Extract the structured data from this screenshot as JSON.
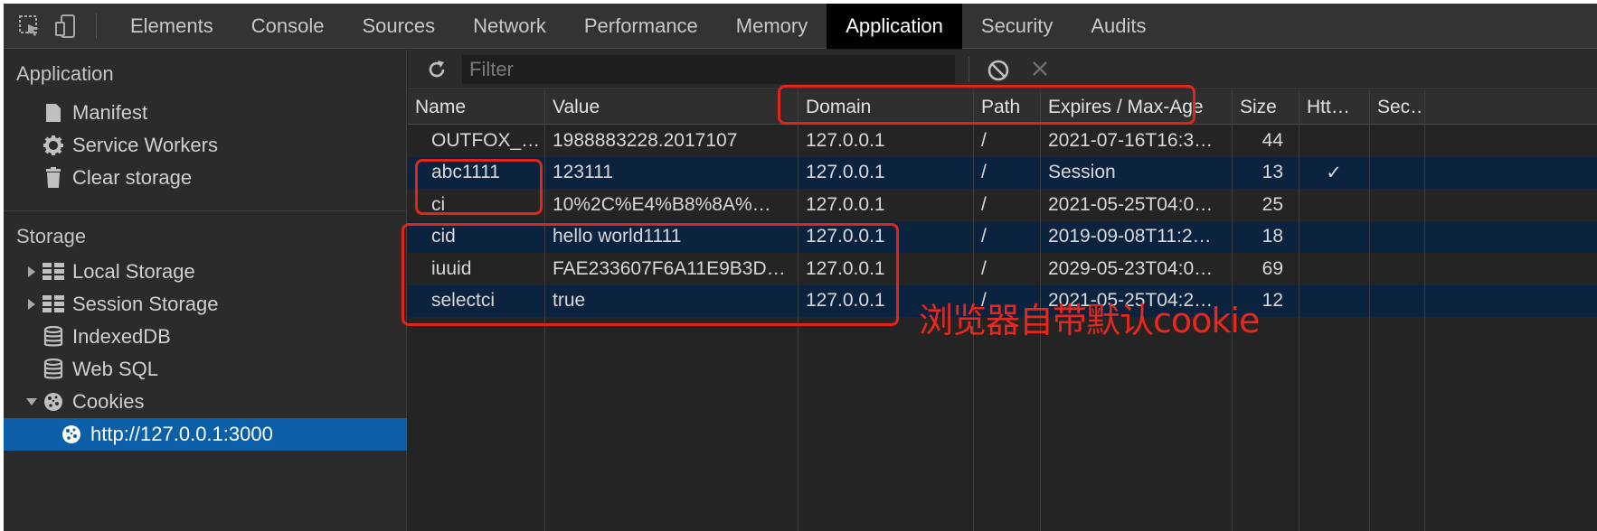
{
  "tabs": [
    "Elements",
    "Console",
    "Sources",
    "Network",
    "Performance",
    "Memory",
    "Application",
    "Security",
    "Audits"
  ],
  "active_tab": "Application",
  "sidebar": {
    "application_title": "Application",
    "application_items": [
      {
        "label": "Manifest",
        "icon": "manifest-icon"
      },
      {
        "label": "Service Workers",
        "icon": "gear-icon"
      },
      {
        "label": "Clear storage",
        "icon": "trash-icon"
      }
    ],
    "storage_title": "Storage",
    "storage_items": [
      {
        "label": "Local Storage",
        "icon": "grid-icon",
        "arrow": "right"
      },
      {
        "label": "Session Storage",
        "icon": "grid-icon",
        "arrow": "right"
      },
      {
        "label": "IndexedDB",
        "icon": "database-icon"
      },
      {
        "label": "Web SQL",
        "icon": "database-icon"
      },
      {
        "label": "Cookies",
        "icon": "cookie-icon",
        "arrow": "down"
      }
    ],
    "selected_item": {
      "label": "http://127.0.0.1:3000",
      "icon": "cookie-icon"
    }
  },
  "toolbar": {
    "filter_placeholder": "Filter"
  },
  "table": {
    "columns": [
      "Name",
      "Value",
      "Domain",
      "Path",
      "Expires / Max-Age",
      "Size",
      "Htt…",
      "Sec…"
    ],
    "rows": [
      {
        "name": "OUTFOX_…",
        "value": "1988883228.2017107",
        "domain": "127.0.0.1",
        "path": "/",
        "expires": "2021-07-16T16:3…",
        "size": "44",
        "http": "",
        "secure": ""
      },
      {
        "name": "abc1111",
        "value": "123111",
        "domain": "127.0.0.1",
        "path": "/",
        "expires": "Session",
        "size": "13",
        "http": "✓",
        "secure": ""
      },
      {
        "name": "ci",
        "value": "10%2C%E4%B8%8A%…",
        "domain": "127.0.0.1",
        "path": "/",
        "expires": "2021-05-25T04:0…",
        "size": "25",
        "http": "",
        "secure": ""
      },
      {
        "name": "cid",
        "value": "hello world1111",
        "domain": "127.0.0.1",
        "path": "/",
        "expires": "2019-09-08T11:2…",
        "size": "18",
        "http": "",
        "secure": ""
      },
      {
        "name": "iuuid",
        "value": "FAE233607F6A11E9B3D…",
        "domain": "127.0.0.1",
        "path": "/",
        "expires": "2029-05-23T04:0…",
        "size": "69",
        "http": "",
        "secure": ""
      },
      {
        "name": "selectci",
        "value": "true",
        "domain": "127.0.0.1",
        "path": "/",
        "expires": "2021-05-25T04:2…",
        "size": "12",
        "http": "",
        "secure": ""
      }
    ]
  },
  "annotation": "浏览器自带默认cookie",
  "colors": {
    "selected": "#0b5ea8",
    "annotation": "#e0251b",
    "row_alt": "#0c2340"
  }
}
